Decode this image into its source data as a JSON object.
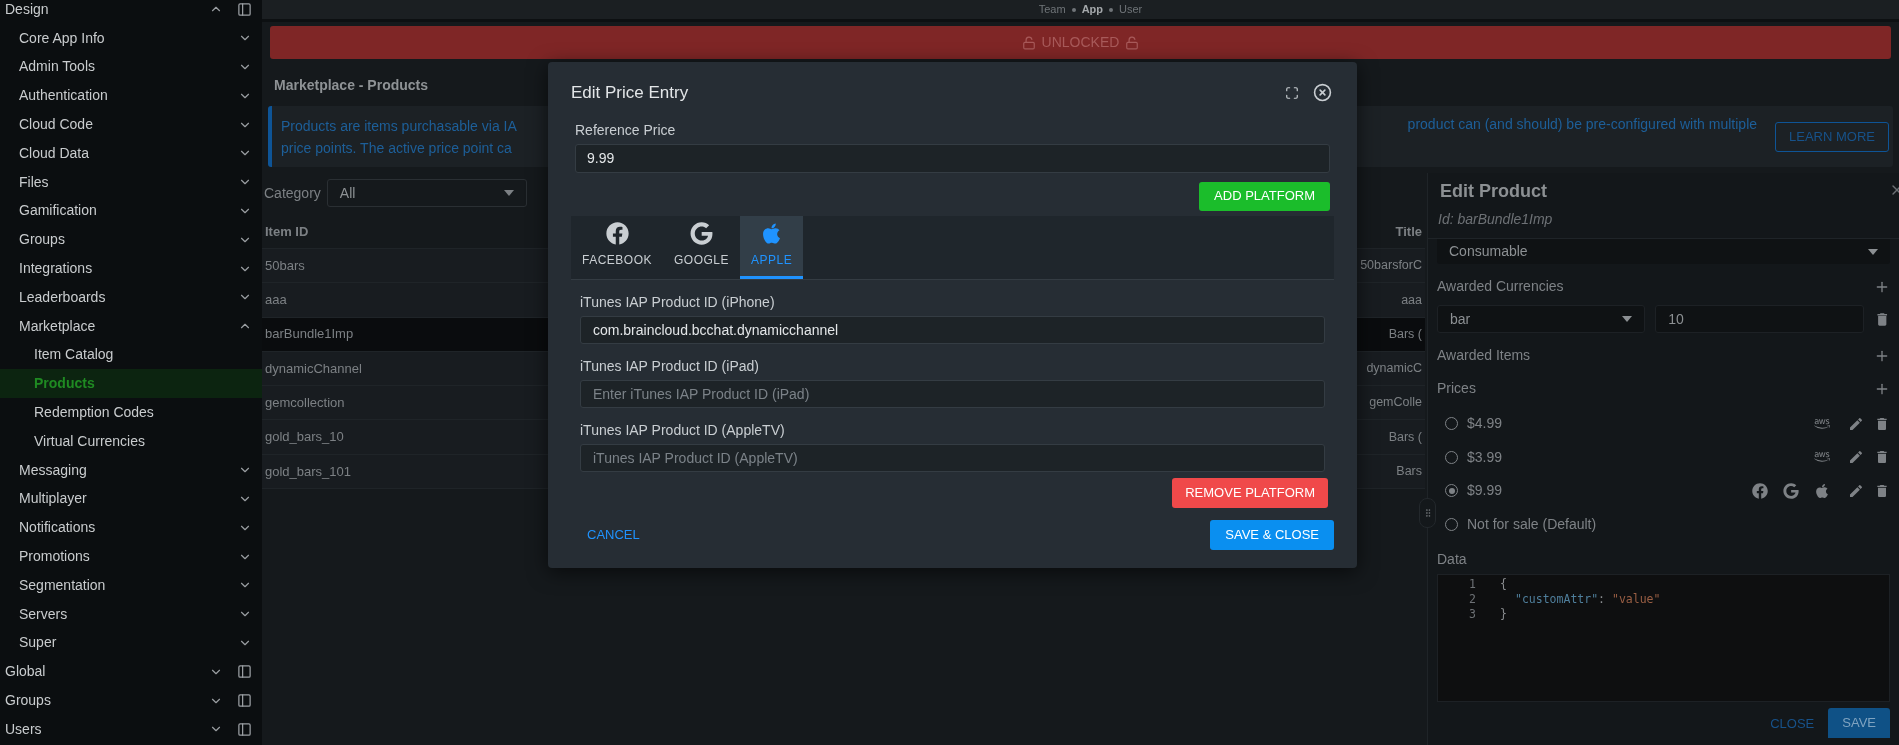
{
  "top_bar": {
    "breadcrumb": [
      {
        "label": "Team",
        "selected": false
      },
      {
        "label": "App",
        "selected": true
      },
      {
        "label": "User",
        "selected": false
      }
    ]
  },
  "sidebar": {
    "sections": [
      {
        "label": "Design",
        "expanded": true,
        "children": [
          {
            "label": "Core App Info",
            "expanded": false
          },
          {
            "label": "Admin Tools",
            "expanded": false
          },
          {
            "label": "Authentication",
            "expanded": false
          },
          {
            "label": "Cloud Code",
            "expanded": false
          },
          {
            "label": "Cloud Data",
            "expanded": false
          },
          {
            "label": "Files",
            "expanded": false
          },
          {
            "label": "Gamification",
            "expanded": false
          },
          {
            "label": "Groups",
            "expanded": false
          },
          {
            "label": "Integrations",
            "expanded": false
          },
          {
            "label": "Leaderboards",
            "expanded": false
          },
          {
            "label": "Marketplace",
            "expanded": true,
            "children": [
              {
                "label": "Item Catalog",
                "selected": false
              },
              {
                "label": "Products",
                "selected": true
              },
              {
                "label": "Redemption Codes",
                "selected": false
              },
              {
                "label": "Virtual Currencies",
                "selected": false
              }
            ]
          },
          {
            "label": "Messaging",
            "expanded": false
          },
          {
            "label": "Multiplayer",
            "expanded": false
          },
          {
            "label": "Notifications",
            "expanded": false
          },
          {
            "label": "Promotions",
            "expanded": false
          },
          {
            "label": "Segmentation",
            "expanded": false
          },
          {
            "label": "Servers",
            "expanded": false
          },
          {
            "label": "Super",
            "expanded": false
          }
        ]
      },
      {
        "label": "Global",
        "expanded": false
      },
      {
        "label": "Groups",
        "expanded": false
      },
      {
        "label": "Users",
        "expanded": false
      }
    ]
  },
  "lock_banner": {
    "label": "UNLOCKED"
  },
  "page_title": "Marketplace - Products",
  "info_banner": {
    "visible_text_left": [
      "Products are items purchasable via IA",
      "price points. The active price point ca"
    ],
    "visible_text_right": "product can (and should) be pre-configured with multiple",
    "button": "LEARN MORE"
  },
  "filter": {
    "label": "Category",
    "value": "All"
  },
  "table": {
    "columns": [
      "Item ID",
      "Title"
    ],
    "rows": [
      {
        "item_id": "50bars",
        "title": "50barsforC",
        "selected": false
      },
      {
        "item_id": "aaa",
        "title": "aaa",
        "selected": false
      },
      {
        "item_id": "barBundle1Imp",
        "title": "Bars (",
        "selected": true
      },
      {
        "item_id": "dynamicChannel",
        "title": "dynamicC",
        "selected": false
      },
      {
        "item_id": "gemcollection",
        "title": "gemColle",
        "selected": false
      },
      {
        "item_id": "gold_bars_10",
        "title": "Bars (",
        "selected": false
      },
      {
        "item_id": "gold_bars_101",
        "title": "Bars",
        "selected": false
      }
    ]
  },
  "edit_product": {
    "title": "Edit Product",
    "id_line": "Id: barBundle1Imp",
    "type": "Consumable",
    "awarded_currencies": {
      "label": "Awarded Currencies",
      "currency": "bar",
      "amount": "10"
    },
    "awarded_items": {
      "label": "Awarded Items"
    },
    "prices": {
      "label": "Prices",
      "items": [
        {
          "label": "$4.99",
          "selected": false,
          "platforms": [
            {
              "kind": "aws"
            }
          ]
        },
        {
          "label": "$3.99",
          "selected": false,
          "platforms": [
            {
              "kind": "aws"
            }
          ]
        },
        {
          "label": "$9.99",
          "selected": true,
          "platforms": [
            {
              "kind": "facebook"
            },
            {
              "kind": "google"
            },
            {
              "kind": "apple"
            }
          ]
        },
        {
          "label": "Not for sale (Default)",
          "selected": false
        }
      ]
    },
    "data": {
      "label": "Data",
      "lines": [
        {
          "number": "1",
          "tokens": [
            {
              "kind": "punct",
              "text": "{"
            }
          ]
        },
        {
          "number": "2",
          "tokens": [
            {
              "kind": "key",
              "text": "\"customAttr\""
            },
            {
              "kind": "punct",
              "text": ":"
            },
            {
              "kind": "string",
              "text": "\"value\""
            }
          ]
        },
        {
          "number": "3",
          "tokens": [
            {
              "kind": "punct",
              "text": "}"
            }
          ]
        }
      ]
    },
    "close_button": "CLOSE",
    "save_button": "SAVE"
  },
  "modal": {
    "title": "Edit Price Entry",
    "reference_price": {
      "label": "Reference Price",
      "value": "9.99"
    },
    "add_button": "ADD PLATFORM",
    "tabs": [
      {
        "label": "FACEBOOK",
        "kind": "facebook",
        "selected": false
      },
      {
        "label": "GOOGLE",
        "kind": "google",
        "selected": false
      },
      {
        "label": "APPLE",
        "kind": "apple",
        "selected": true
      }
    ],
    "fields": [
      {
        "label": "iTunes IAP Product ID (iPhone)",
        "value": "com.braincloud.bcchat.dynamicchannel"
      },
      {
        "label": "iTunes IAP Product ID (iPad)",
        "placeholder": "Enter iTunes IAP Product ID (iPad)"
      },
      {
        "label": "iTunes IAP Product ID (AppleTV)",
        "placeholder": "iTunes IAP Product ID (AppleTV)"
      }
    ],
    "remove_button": "REMOVE PLATFORM",
    "cancel_button": "CANCEL",
    "save_button": "SAVE & CLOSE"
  }
}
